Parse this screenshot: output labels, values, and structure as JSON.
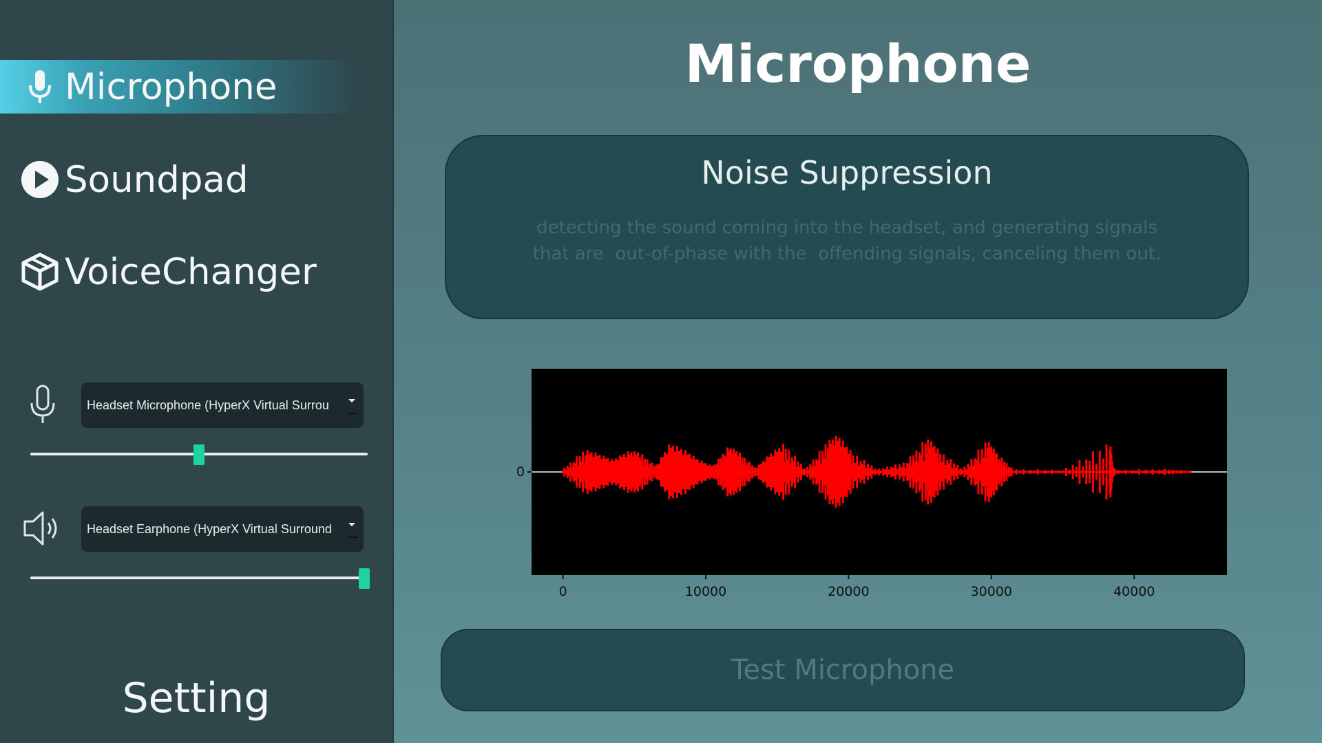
{
  "sidebar": {
    "nav": [
      {
        "label": "Microphone",
        "icon": "microphone-icon",
        "active": true
      },
      {
        "label": "Soundpad",
        "icon": "play-circle-icon",
        "active": false
      },
      {
        "label": "VoiceChanger",
        "icon": "cube-icon",
        "active": false
      }
    ],
    "input_device": {
      "selected": "Headset Microphone (HyperX Virtual Surrou",
      "icon": "microphone-outline-icon",
      "volume": 0.5
    },
    "output_device": {
      "selected": "Headset Earphone (HyperX Virtual Surround",
      "icon": "speaker-icon",
      "volume": 1.0
    },
    "setting_label": "Setting"
  },
  "main": {
    "title": "Microphone",
    "card": {
      "title": "Noise Suppression",
      "description": "detecting the sound coming into the headset, and generating signals\nthat are  out-of-phase with the  offending signals, canceling them out."
    },
    "test_button_label": "Test Microphone"
  },
  "colors": {
    "accent": "#56cfe6",
    "slider_handle": "#1fd3a0",
    "waveform": "#ff0000",
    "plot_bg": "#000000"
  },
  "chart_data": {
    "type": "line",
    "title": "",
    "xlabel": "",
    "ylabel": "",
    "xlim": [
      -2200,
      46500
    ],
    "xticks": [
      0,
      10000,
      20000,
      30000,
      40000
    ],
    "yticks": [
      0
    ],
    "grid": false,
    "series": [
      {
        "x": [
          0,
          1500,
          2500,
          3500,
          4500,
          5300,
          6500,
          7500,
          8500,
          9500,
          10500,
          11600,
          12300,
          13500,
          14500,
          15500,
          17000,
          18500,
          19300,
          20200,
          22000,
          24000,
          25500,
          26300,
          28000,
          29700,
          30300,
          31500,
          35000,
          38300,
          38500,
          38700,
          42000,
          44000
        ],
        "amplitude": [
          0.03,
          0.22,
          0.18,
          0.12,
          0.2,
          0.2,
          0.06,
          0.28,
          0.22,
          0.12,
          0.06,
          0.25,
          0.2,
          0.04,
          0.18,
          0.28,
          0.03,
          0.3,
          0.36,
          0.2,
          0.03,
          0.1,
          0.34,
          0.22,
          0.03,
          0.32,
          0.2,
          0.03,
          0.02,
          0.3,
          0.05,
          0.02,
          0.03,
          0.01
        ]
      }
    ]
  }
}
